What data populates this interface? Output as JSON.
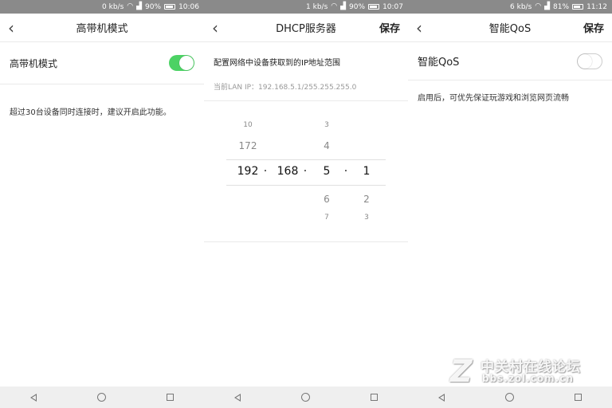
{
  "panel1": {
    "status": {
      "speed": "0 kb/s",
      "battery": "90%",
      "time": "10:06",
      "battery_level": 0.9
    },
    "title": "高带机模式",
    "row_label": "高带机模式",
    "toggle_on": true,
    "description": "超过30台设备同时连接时，建议开启此功能。"
  },
  "panel2": {
    "status": {
      "speed": "1 kb/s",
      "battery": "90%",
      "time": "10:07",
      "battery_level": 0.9
    },
    "title": "DHCP服务器",
    "save": "保存",
    "heading": "配置网络中设备获取到的IP地址范围",
    "lan_ip": "当前LAN IP：192.168.5.1/255.255.255.0",
    "picker": {
      "col1": {
        "above2": "10",
        "above1": "172",
        "selected": "192",
        "below1": "",
        "below2": ""
      },
      "col2": {
        "selected": "168"
      },
      "col3": {
        "above2": "3",
        "above1": "4",
        "selected": "5",
        "below1": "6",
        "below2": "7"
      },
      "col4": {
        "above2": "",
        "above1": "",
        "selected": "1",
        "below1": "2",
        "below2": "3"
      },
      "dot": "·"
    }
  },
  "panel3": {
    "status": {
      "speed": "6 kb/s",
      "battery": "81%",
      "time": "11:12",
      "battery_level": 0.81
    },
    "title": "智能QoS",
    "save": "保存",
    "row_label": "智能QoS",
    "toggle_on": false,
    "description": "启用后，可优先保证玩游戏和浏览网页流畅"
  },
  "watermark": {
    "letter": "Z",
    "name": "中关村在线论坛",
    "url": "bbs.zol.com.cn"
  },
  "icons": {
    "back": "chevron-left-icon",
    "wifi": "wifi-icon",
    "signal": "signal-icon",
    "battery": "battery-icon"
  }
}
